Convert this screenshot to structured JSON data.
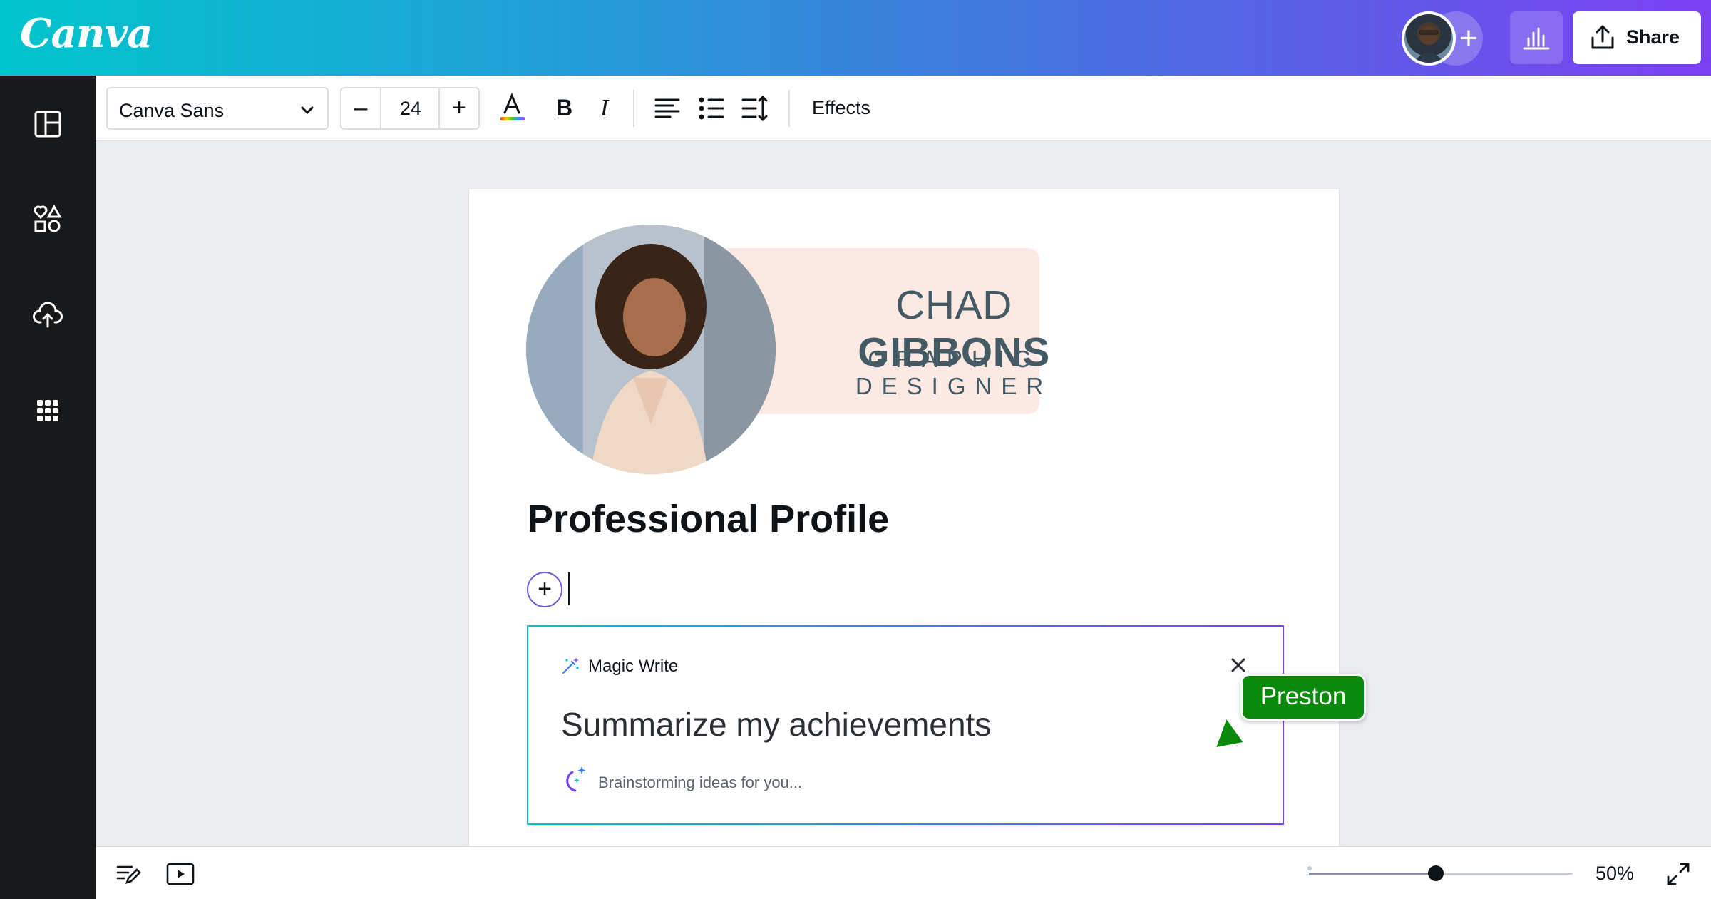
{
  "app": {
    "logo": "Canva",
    "share_label": "Share"
  },
  "toolbar": {
    "font_family": "Canva Sans",
    "font_size": "24",
    "effects_label": "Effects"
  },
  "page": {
    "name_first": "CHAD ",
    "name_last": "GIBBONS",
    "role": "GRAPHIC DESIGNER",
    "heading": "Professional Profile"
  },
  "magic_write": {
    "title": "Magic Write",
    "prompt": "Summarize my achievements",
    "status": "Brainstorming ideas for you..."
  },
  "collaborator": {
    "name": "Preston",
    "color": "#0a8a0a"
  },
  "zoom": {
    "label": "50%",
    "value": 0.48
  },
  "colors": {
    "accent_start": "#00c4cc",
    "accent_end": "#7b3ff2",
    "banner_bg": "#fde9e3",
    "name_color": "#445a65"
  }
}
